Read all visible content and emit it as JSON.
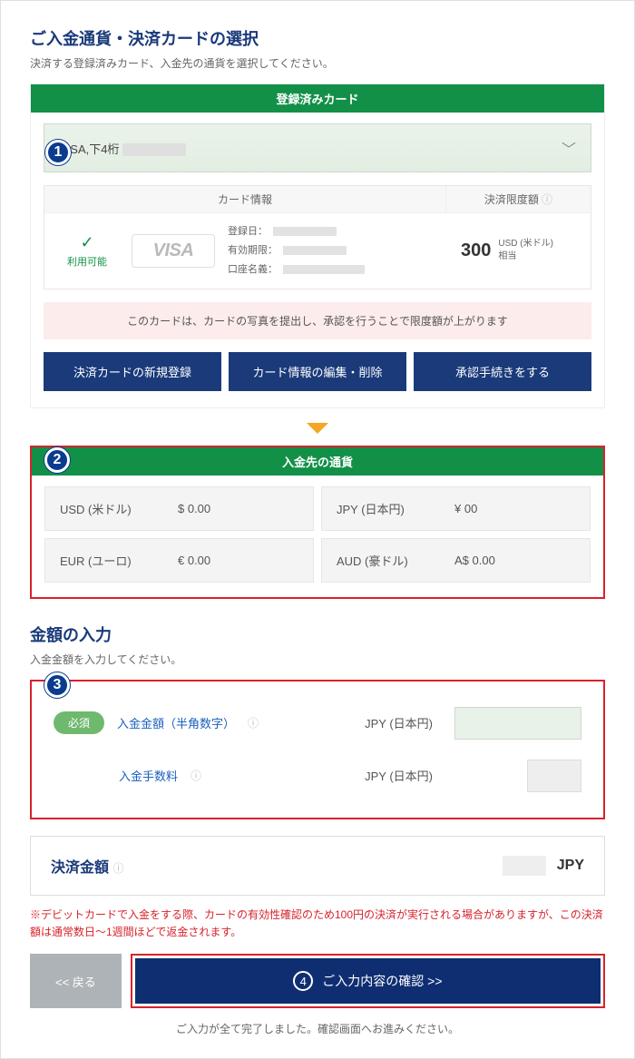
{
  "section1": {
    "title": "ご入金通貨・決済カードの選択",
    "sub": "決済する登録済みカード、入金先の通貨を選択してください。",
    "card_header": "登録済みカード",
    "dropdown_label": "VISA,下4桁",
    "info_head_card": "カード情報",
    "info_head_limit": "決済限度額",
    "status_text": "利用可能",
    "brand_text": "VISA",
    "reg_date_label": "登録日：",
    "expiry_label": "有効期限：",
    "acct_label": "口座名義：",
    "limit_amount": "300",
    "limit_unit1": "USD (米ドル)",
    "limit_unit2": "相当",
    "pink_notice": "このカードは、カードの写真を提出し、承認を行うことで限度額が上がります",
    "btn_new": "決済カードの新規登録",
    "btn_edit": "カード情報の編集・削除",
    "btn_approve": "承認手続きをする"
  },
  "section2": {
    "header": "入金先の通貨",
    "items": [
      {
        "name": "USD (米ドル)",
        "value": "$ 0.00"
      },
      {
        "name": "JPY (日本円)",
        "value": "¥ 00"
      },
      {
        "name": "EUR (ユーロ)",
        "value": "€ 0.00"
      },
      {
        "name": "AUD (豪ドル)",
        "value": "A$ 0.00"
      }
    ]
  },
  "section3": {
    "title": "金額の入力",
    "sub": "入金金額を入力してください。",
    "required_tag": "必須",
    "amount_label": "入金金額（半角数字）",
    "fee_label": "入金手数料",
    "curr_hint": "JPY (日本円)"
  },
  "settle": {
    "label": "決済金額",
    "unit": "JPY"
  },
  "warn": "※デビットカードで入金をする際、カードの有効性確認のため100円の決済が実行される場合がありますが、この決済額は通常数日～1週間ほどで返金されます。",
  "actions": {
    "back": "<< 戻る",
    "confirm": "ご入力内容の確認 >>",
    "confirm_num": "4"
  },
  "footer": "ご入力が全て完了しました。確認画面へお進みください。"
}
